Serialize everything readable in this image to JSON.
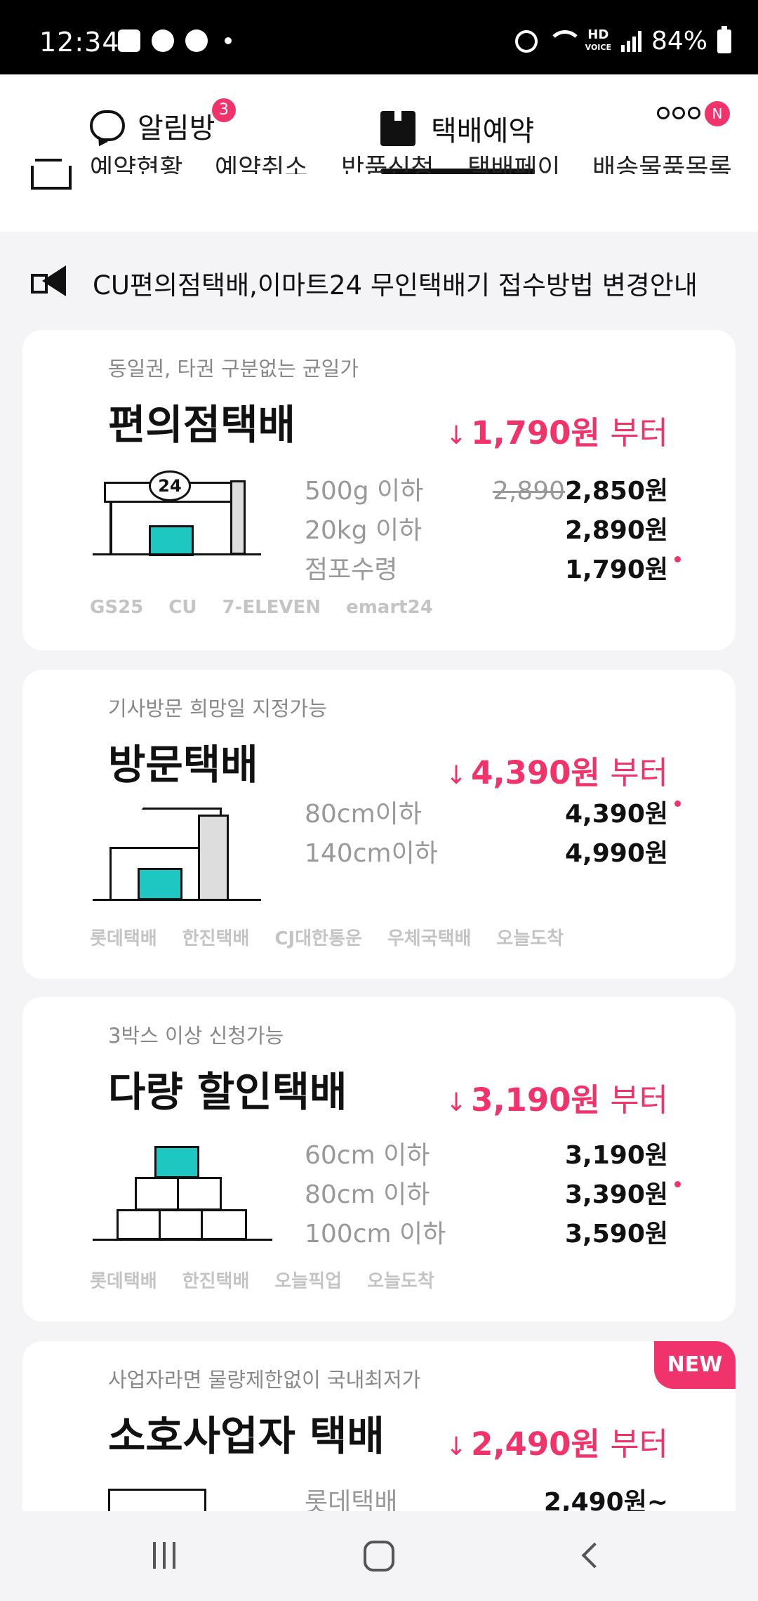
{
  "status_bar": {
    "time": "12:34",
    "battery": "84%",
    "network": "HD VOICE",
    "icons": [
      "gallery-icon",
      "accessibility-icon",
      "facebook-icon",
      "dot-icon",
      "alarm-icon",
      "wifi-icon",
      "signal-icon",
      "battery-icon"
    ]
  },
  "header": {
    "alarm_label": "알림방",
    "alarm_badge": "3",
    "center_label": "택배예약",
    "more_badge": "N"
  },
  "subnav": {
    "items": [
      "예약현황",
      "예약취소",
      "반품신청",
      "택배페이",
      "배송물품목록"
    ]
  },
  "notice": {
    "text": "CU편의점택배,이마트24 무인택배기 접수방법 변경안내"
  },
  "cards": [
    {
      "subtitle": "동일권, 타권 구분없는 균일가",
      "title": "편의점택배",
      "price_value": "1,790원",
      "price_suffix": " 부터",
      "rows": [
        {
          "label": "500g 이하",
          "old": "2,890",
          "price": "2,850원"
        },
        {
          "label": "20kg 이하",
          "price": "2,890원"
        },
        {
          "label": "점포수령",
          "price": "1,790원"
        }
      ],
      "carriers": [
        "GS25",
        "CU",
        "7-ELEVEN",
        "emart24"
      ],
      "store_number": "24"
    },
    {
      "subtitle": "기사방문 희망일 지정가능",
      "title": "방문택배",
      "price_value": "4,390원",
      "price_suffix": " 부터",
      "rows": [
        {
          "label": "80cm이하",
          "price": "4,390원"
        },
        {
          "label": "140cm이하",
          "price": "4,990원"
        }
      ],
      "carriers": [
        "롯데택배",
        "한진택배",
        "CJ대한통운",
        "우체국택배",
        "오늘도착"
      ]
    },
    {
      "subtitle": "3박스 이상 신청가능",
      "title": "다량 할인택배",
      "price_value": "3,190원",
      "price_suffix": " 부터",
      "rows": [
        {
          "label": "60cm 이하",
          "price": "3,190원"
        },
        {
          "label": "80cm 이하",
          "price": "3,390원"
        },
        {
          "label": "100cm 이하",
          "price": "3,590원"
        }
      ],
      "carriers": [
        "롯데택배",
        "한진택배",
        "오늘픽업",
        "오늘도착"
      ]
    },
    {
      "badge": "NEW",
      "subtitle": "사업자라면 물량제한없이 국내최저가",
      "title": "소호사업자 택배",
      "price_value": "2,490원",
      "price_suffix": " 부터",
      "rows": [
        {
          "label": "롯데택배",
          "price": "2,490원~"
        }
      ]
    }
  ],
  "colors": {
    "accent": "#f0346b",
    "teal": "#1fc7c2",
    "background": "#f4f4f6"
  }
}
